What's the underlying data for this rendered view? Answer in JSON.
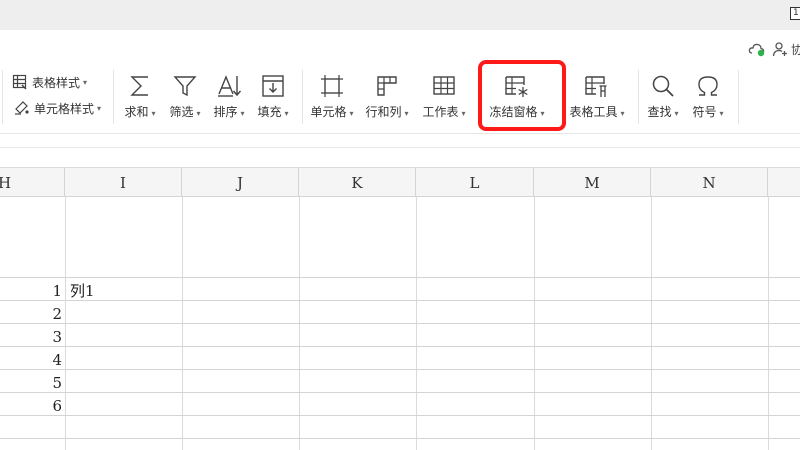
{
  "titlebar": {
    "window_button_label": "1"
  },
  "collab": {
    "share_label": "协"
  },
  "ribbon": {
    "table_style_label": "表格样式",
    "cell_style_label": "单元格样式",
    "sum_label": "求和",
    "filter_label": "筛选",
    "sort_label": "排序",
    "fill_label": "填充",
    "cell_label": "单元格",
    "rowcol_label": "行和列",
    "worksheet_label": "工作表",
    "freeze_label": "冻结窗格",
    "tabletools_label": "表格工具",
    "find_label": "查找",
    "symbol_label": "符号",
    "dropdown_glyph": "▾",
    "highlight_color": "#ff1a1a"
  },
  "columns": [
    "H",
    "I",
    "J",
    "K",
    "L",
    "M",
    "N"
  ],
  "rows": [
    {
      "num": "1",
      "value": "列1"
    },
    {
      "num": "2",
      "value": ""
    },
    {
      "num": "3",
      "value": ""
    },
    {
      "num": "4",
      "value": ""
    },
    {
      "num": "5",
      "value": ""
    },
    {
      "num": "6",
      "value": ""
    }
  ]
}
